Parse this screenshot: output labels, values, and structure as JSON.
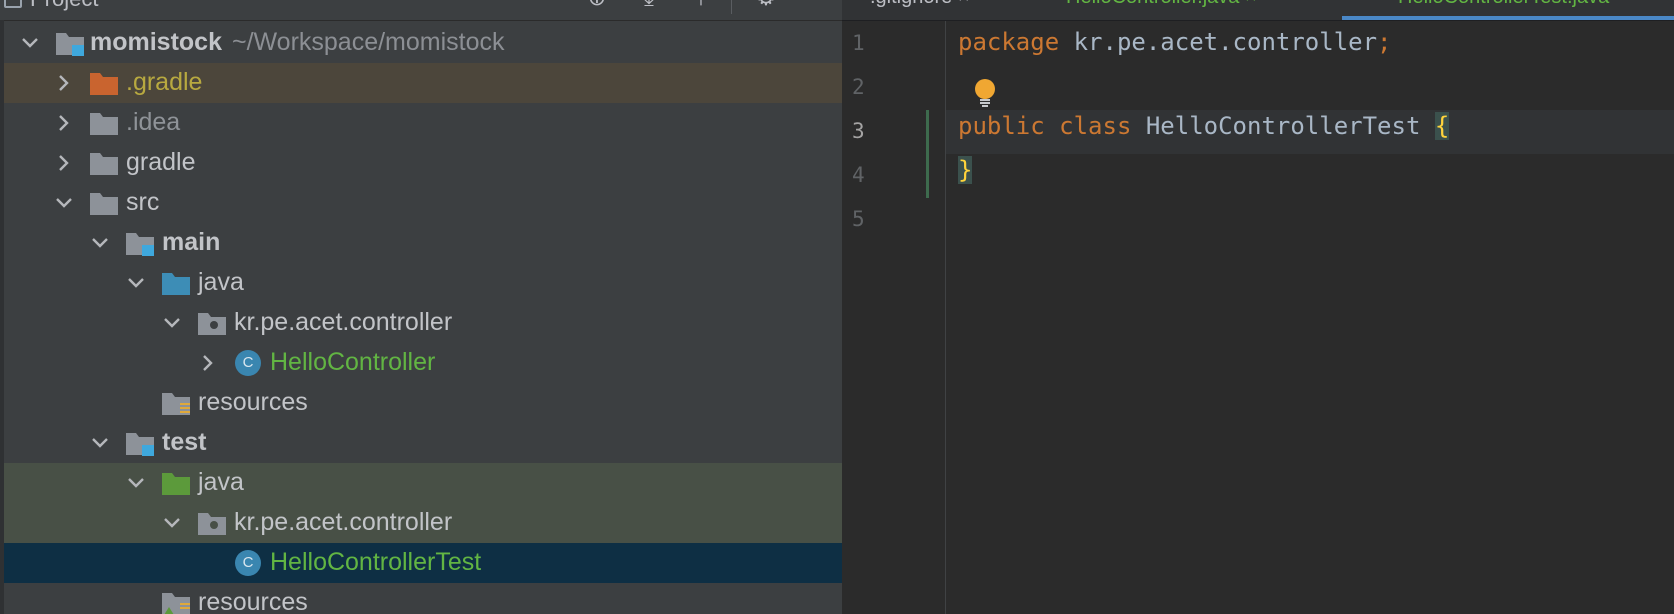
{
  "project_panel": {
    "header_title": "Project",
    "tree": [
      {
        "label": "momistock",
        "sub": "~/Workspace/momistock"
      },
      {
        "label": ".gradle"
      },
      {
        "label": ".idea"
      },
      {
        "label": "gradle"
      },
      {
        "label": "src"
      },
      {
        "label": "main"
      },
      {
        "label": "java"
      },
      {
        "label": "kr.pe.acet.controller"
      },
      {
        "label": "HelloController"
      },
      {
        "label": "resources"
      },
      {
        "label": "test"
      },
      {
        "label": "java"
      },
      {
        "label": "kr.pe.acet.controller"
      },
      {
        "label": "HelloControllerTest"
      },
      {
        "label": "resources"
      }
    ]
  },
  "editor": {
    "tabs": [
      {
        "label": ".gitignore"
      },
      {
        "label": "HelloController.java"
      },
      {
        "label": "HelloControllerTest.java"
      }
    ],
    "line_numbers": [
      "1",
      "2",
      "3",
      "4",
      "5"
    ],
    "code": {
      "l1_kw": "package",
      "l1_pkg": " kr.pe.acet.controller",
      "l1_semi": ";",
      "l3_kw1": "public",
      "l3_kw2": " class",
      "l3_cls": " HelloControllerTest ",
      "l3_brace": "{",
      "l4_brace": "}"
    }
  },
  "colors": {
    "keyword": "#cc7832",
    "class_name_green": "#62b543",
    "selection": "#0e2f44",
    "brace_highlight": "#ffd43b"
  }
}
